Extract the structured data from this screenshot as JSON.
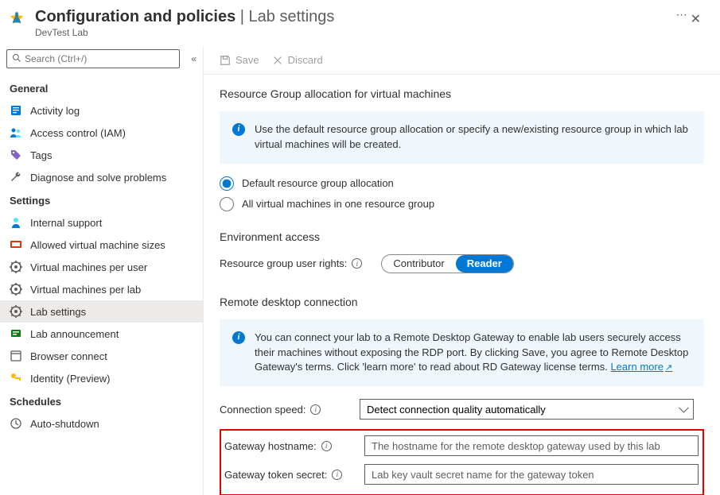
{
  "header": {
    "title_strong": "Configuration and policies",
    "title_light": " | Lab settings",
    "subtitle": "DevTest Lab"
  },
  "search": {
    "placeholder": "Search (Ctrl+/)"
  },
  "sidebar": {
    "groups": {
      "general": "General",
      "settings": "Settings",
      "schedules": "Schedules"
    },
    "items": {
      "activity_log": "Activity log",
      "access_control": "Access control (IAM)",
      "tags": "Tags",
      "diagnose": "Diagnose and solve problems",
      "internal_support": "Internal support",
      "vm_sizes": "Allowed virtual machine sizes",
      "vm_per_user": "Virtual machines per user",
      "vm_per_lab": "Virtual machines per lab",
      "lab_settings": "Lab settings",
      "lab_announcement": "Lab announcement",
      "browser_connect": "Browser connect",
      "identity": "Identity (Preview)",
      "auto_shutdown": "Auto-shutdown"
    }
  },
  "toolbar": {
    "save": "Save",
    "discard": "Discard"
  },
  "main": {
    "rg_title": "Resource Group allocation for virtual machines",
    "rg_banner": "Use the default resource group allocation or specify a new/existing resource group in which lab virtual machines will be created.",
    "rg_opt_default": "Default resource group allocation",
    "rg_opt_all": "All virtual machines in one resource group",
    "env_title": "Environment access",
    "env_label": "Resource group user rights:",
    "env_contrib": "Contributor",
    "env_reader": "Reader",
    "rdp_title": "Remote desktop connection",
    "rdp_banner": "You can connect your lab to a Remote Desktop Gateway to enable lab users securely access their machines without exposing the RDP port. By clicking Save, you agree to Remote Desktop Gateway's terms.  Click 'learn more' to read about RD Gateway license terms. ",
    "learn_more": "Learn more",
    "conn_label": "Connection speed:",
    "conn_value": "Detect connection quality automatically",
    "gw_host_label": "Gateway hostname:",
    "gw_host_ph": "The hostname for the remote desktop gateway used by this lab",
    "gw_secret_label": "Gateway token secret:",
    "gw_secret_ph": "Lab key vault secret name for the gateway token"
  }
}
